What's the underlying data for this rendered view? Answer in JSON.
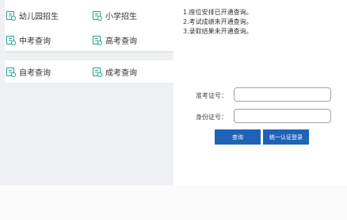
{
  "menu": {
    "items": [
      {
        "label": "幼儿园招生",
        "icon": "document-icon"
      },
      {
        "label": "小学招生",
        "icon": "document-icon"
      },
      {
        "label": "中考查询",
        "icon": "document-icon"
      },
      {
        "label": "高考查询",
        "icon": "document-icon"
      },
      {
        "label": "自考查询",
        "icon": "document-icon"
      },
      {
        "label": "成考查询",
        "icon": "document-icon"
      }
    ]
  },
  "notice": {
    "lines": [
      "1.座位安排已开通查询。",
      "2.考试成绩未开通查询。",
      "3.录取结果未开通查询。"
    ]
  },
  "form": {
    "exam_number_label": "准考证号：",
    "exam_number_value": "",
    "id_number_label": "身份证号：",
    "id_number_value": "",
    "query_button": "查询",
    "unified_login_button": "统一认证登录"
  },
  "colors": {
    "accent": "#1f63b8",
    "icon": "#1aa38a",
    "panel_background": "#eef0f4"
  }
}
